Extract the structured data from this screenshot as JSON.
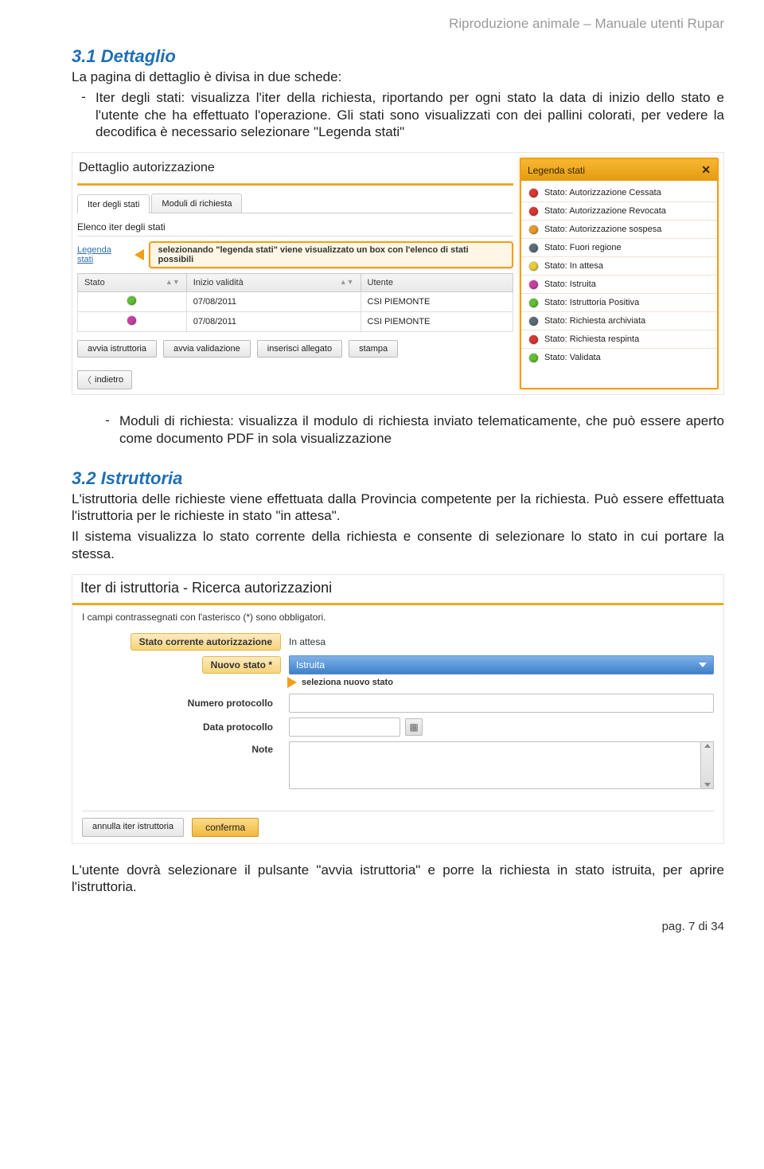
{
  "header": {
    "doc_title": "Riproduzione animale – Manuale utenti Rupar"
  },
  "section31": {
    "heading": "3.1  Dettaglio",
    "intro": "La pagina di dettaglio è divisa in due schede:",
    "bullet_dash": "-",
    "bullet1": "Iter degli stati: visualizza l'iter della richiesta, riportando per ogni stato la data di inizio dello stato e l'utente che ha effettuato l'operazione. Gli stati sono visualizzati con dei pallini colorati, per vedere la decodifica è necessario selezionare \"Legenda stati\""
  },
  "shot1": {
    "panel_title": "Dettaglio autorizzazione",
    "tabs": {
      "active": "Iter degli stati",
      "other": "Moduli di richiesta"
    },
    "section_label": "Elenco iter degli stati",
    "legend_link": "Legenda stati",
    "callout": "selezionando \"legenda stati\" viene visualizzato un box con l'elenco di stati possibili",
    "columns": {
      "stato": "Stato",
      "inizio": "Inizio validità",
      "utente": "Utente"
    },
    "rows": [
      {
        "dot": "green",
        "date": "07/08/2011",
        "user": "CSI PIEMONTE"
      },
      {
        "dot": "magenta",
        "date": "07/08/2011",
        "user": "CSI PIEMONTE"
      }
    ],
    "buttons": {
      "b1": "avvia istruttoria",
      "b2": "avvia validazione",
      "b3": "inserisci allegato",
      "b4": "stampa"
    },
    "back": "indietro",
    "legend": {
      "title": "Legenda stati",
      "items": [
        {
          "dot": "red",
          "label": "Stato: Autorizzazione Cessata"
        },
        {
          "dot": "red",
          "label": "Stato: Autorizzazione Revocata"
        },
        {
          "dot": "orange",
          "label": "Stato: Autorizzazione sospesa"
        },
        {
          "dot": "slate",
          "label": "Stato: Fuori regione"
        },
        {
          "dot": "yellow",
          "label": "Stato: In attesa"
        },
        {
          "dot": "magenta",
          "label": "Stato: Istruita"
        },
        {
          "dot": "green",
          "label": "Stato: Istruttoria Positiva"
        },
        {
          "dot": "slate",
          "label": "Stato: Richiesta archiviata"
        },
        {
          "dot": "red",
          "label": "Stato: Richiesta respinta"
        },
        {
          "dot": "green",
          "label": "Stato: Validata"
        }
      ]
    }
  },
  "mid_bullet": {
    "dash": "-",
    "text": "Moduli di richiesta: visualizza il modulo di richiesta inviato telematicamente, che può essere aperto come documento PDF in sola visualizzazione"
  },
  "section32": {
    "heading": "3.2  Istruttoria",
    "p1": "L'istruttoria delle richieste viene effettuata dalla Provincia competente per la richiesta. Può essere effettuata l'istruttoria per le richieste in stato \"in attesa\".",
    "p2": "Il sistema visualizza lo stato corrente della richiesta e consente di selezionare lo stato in cui portare la stessa."
  },
  "shot2": {
    "title": "Iter di istruttoria - Ricerca autorizzazioni",
    "mandatory_note": "I campi contrassegnati con l'asterisco (*) sono obbligatori.",
    "rows": {
      "stato_label": "Stato corrente autorizzazione",
      "stato_value": "In attesa",
      "nuovo_label": "Nuovo stato *",
      "nuovo_value": "Istruita",
      "hint": "seleziona nuovo stato",
      "numproto_label": "Numero protocollo",
      "dataproto_label": "Data protocollo",
      "note_label": "Note"
    },
    "buttons": {
      "cancel": "annulla iter istruttoria",
      "confirm": "conferma"
    }
  },
  "closing": "L'utente dovrà selezionare il pulsante \"avvia istruttoria\" e porre la richiesta in stato istruita, per aprire l'istruttoria.",
  "footer": "pag. 7 di 34"
}
